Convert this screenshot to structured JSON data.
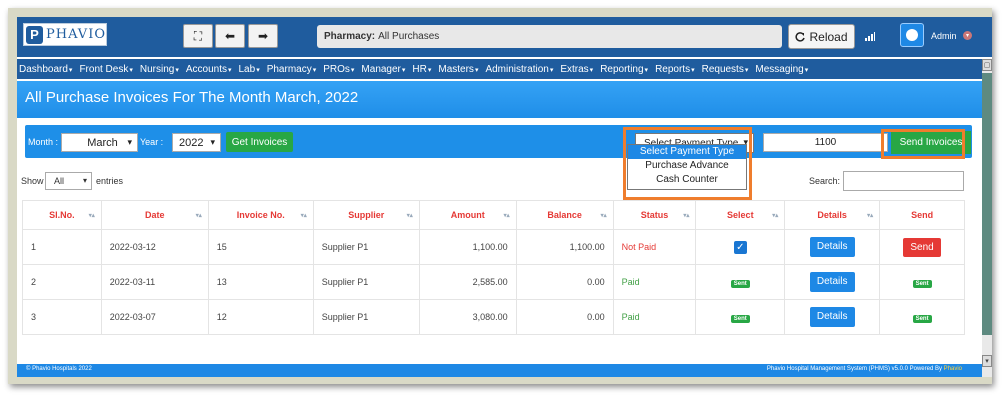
{
  "app": {
    "logo_text": "PHAVIO",
    "logo_mark": "P"
  },
  "toolbar": {
    "expand_icon": "⛶",
    "back_icon": "⬅",
    "forward_icon": "➡"
  },
  "breadcrumb": {
    "module": "Pharmacy:",
    "page": "All Purchases"
  },
  "reload_label": "Reload",
  "user": {
    "name": "Admin"
  },
  "nav": [
    "Dashboard",
    "Front Desk",
    "Nursing",
    "Accounts",
    "Lab",
    "Pharmacy",
    "PROs",
    "Manager",
    "HR",
    "Masters",
    "Administration",
    "Extras",
    "Reporting",
    "Reports",
    "Requests",
    "Messaging"
  ],
  "page_title": "All Purchase Invoices For The Month March, 2022",
  "filter": {
    "month_label": "Month :",
    "month_value": "March",
    "year_label": "Year :",
    "year_value": "2022",
    "get_invoices": "Get Invoices",
    "payment_type_value": "Select Payment Type",
    "payment_type_options": [
      "Select Payment Type",
      "Purchase Advance",
      "Cash Counter"
    ],
    "amount_value": "1100",
    "send_invoices": "Send Invoices"
  },
  "table_controls": {
    "show_label": "Show",
    "show_value": "All",
    "entries_label": "entries",
    "search_label": "Search:"
  },
  "table": {
    "headers": [
      "Sl.No.",
      "Date",
      "Invoice No.",
      "Supplier",
      "Amount",
      "Balance",
      "Status",
      "Select",
      "Details",
      "Send"
    ],
    "rows": [
      {
        "sl": "1",
        "date": "2022-03-12",
        "invoice": "15",
        "supplier": "Supplier P1",
        "amount": "1,100.00",
        "balance": "1,100.00",
        "status": "Not Paid",
        "select": "checkbox",
        "details": "Details",
        "send": "Send"
      },
      {
        "sl": "2",
        "date": "2022-03-11",
        "invoice": "13",
        "supplier": "Supplier P1",
        "amount": "2,585.00",
        "balance": "0.00",
        "status": "Paid",
        "select": "Sent",
        "details": "Details",
        "send": "Sent"
      },
      {
        "sl": "3",
        "date": "2022-03-07",
        "invoice": "12",
        "supplier": "Supplier P1",
        "amount": "3,080.00",
        "balance": "0.00",
        "status": "Paid",
        "select": "Sent",
        "details": "Details",
        "send": "Sent"
      }
    ]
  },
  "footer": {
    "left": "© Phavio Hospitals 2022",
    "right": "Phavio Hospital Management System (PHMS) v5.0.0 Powered By",
    "brand": "Phavio"
  },
  "colors": {
    "header": "#1f5c9e",
    "accent": "#2196f3",
    "success": "#28a745",
    "danger": "#e53935",
    "highlight": "#ef7d2d"
  }
}
